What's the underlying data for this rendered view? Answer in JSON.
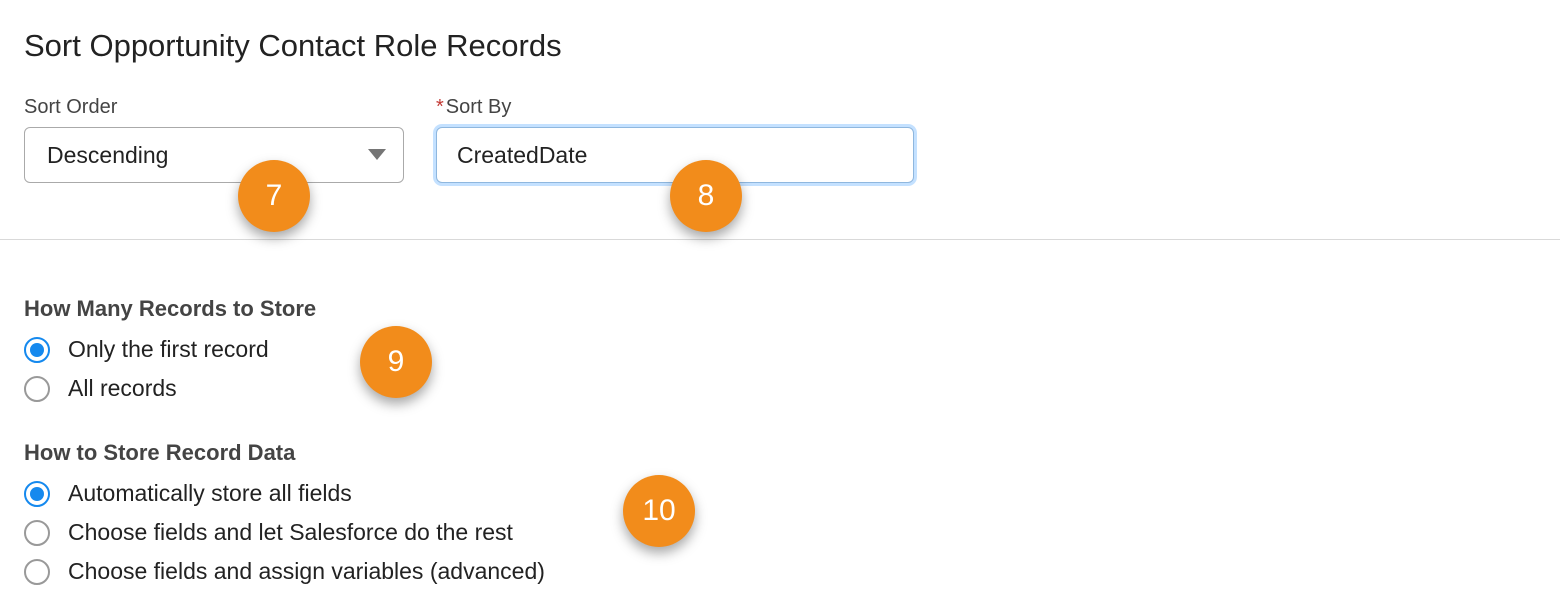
{
  "section_title": "Sort Opportunity Contact Role Records",
  "sort_order": {
    "label": "Sort Order",
    "value": "Descending"
  },
  "sort_by": {
    "label": "Sort By",
    "required_mark": "*",
    "value": "CreatedDate"
  },
  "how_many": {
    "title": "How Many Records to Store",
    "options": [
      {
        "label": "Only the first record",
        "selected": true
      },
      {
        "label": "All records",
        "selected": false
      }
    ]
  },
  "how_store": {
    "title": "How to Store Record Data",
    "options": [
      {
        "label": "Automatically store all fields",
        "selected": true
      },
      {
        "label": "Choose fields and let Salesforce do the rest",
        "selected": false
      },
      {
        "label": "Choose fields and assign variables (advanced)",
        "selected": false
      }
    ]
  },
  "callouts": {
    "c7": "7",
    "c8": "8",
    "c9": "9",
    "c10": "10"
  }
}
